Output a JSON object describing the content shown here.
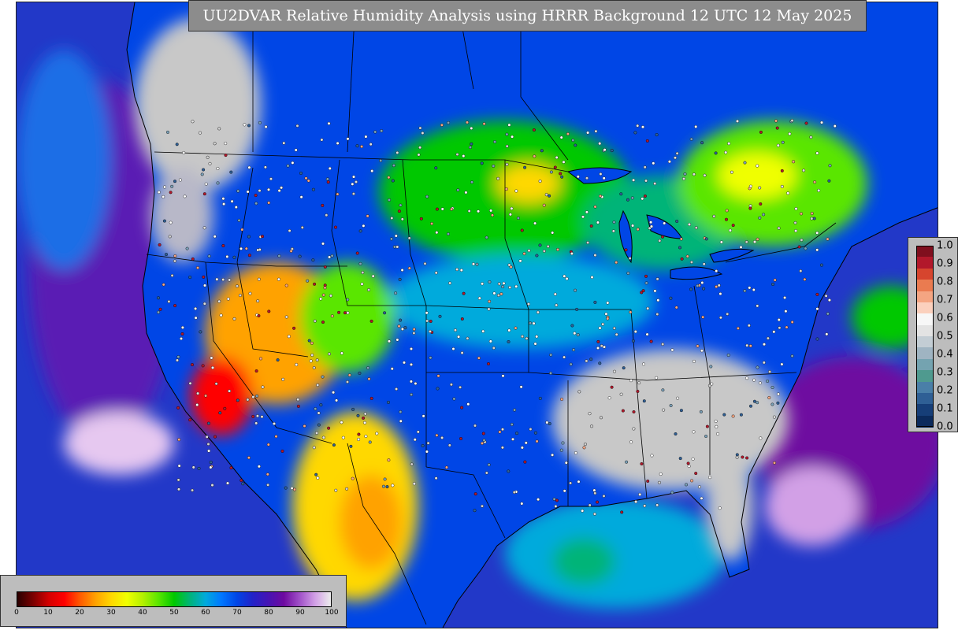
{
  "title": "UU2DVAR Relative Humidity Analysis using HRRR Background 12 UTC 12 May 2025",
  "rh_legend": {
    "ticks": [
      "0",
      "10",
      "20",
      "30",
      "40",
      "50",
      "60",
      "70",
      "80",
      "90",
      "100"
    ],
    "colors": [
      "#2a0000",
      "#7a0000",
      "#d40000",
      "#ff0000",
      "#ff5a00",
      "#ffa200",
      "#ffd800",
      "#f0ff00",
      "#b4f000",
      "#5ae600",
      "#00c800",
      "#00b478",
      "#00aadc",
      "#0078ff",
      "#0046e6",
      "#2222c8",
      "#4614b4",
      "#6e0aa0",
      "#a050c8",
      "#d2a0e6",
      "#ececec"
    ]
  },
  "incremental_legend": {
    "ticks": [
      "1.0",
      "0.9",
      "0.8",
      "0.7",
      "0.6",
      "0.5",
      "0.4",
      "0.3",
      "0.2",
      "0.1",
      "0.0"
    ],
    "colors": [
      "#7f0f1e",
      "#b2182b",
      "#d6452e",
      "#ea7b50",
      "#f4a582",
      "#fbd0bd",
      "#f7f7f7",
      "#e3e3e3",
      "#c3cdd4",
      "#9fb4c2",
      "#74a3b0",
      "#4f9a8f",
      "#4a7fa8",
      "#2f5f95",
      "#163e78",
      "#0b2a5c"
    ]
  },
  "colors": {
    "ocean": "#2238c8",
    "land_humid": "#00c800",
    "dry_land": "#ffa200",
    "southeast_gray": "#c8c8c8",
    "canada_gray": "#c0c0c0",
    "panel_gray": "#bdbdbd",
    "title_bg": "#8c8c8c"
  }
}
